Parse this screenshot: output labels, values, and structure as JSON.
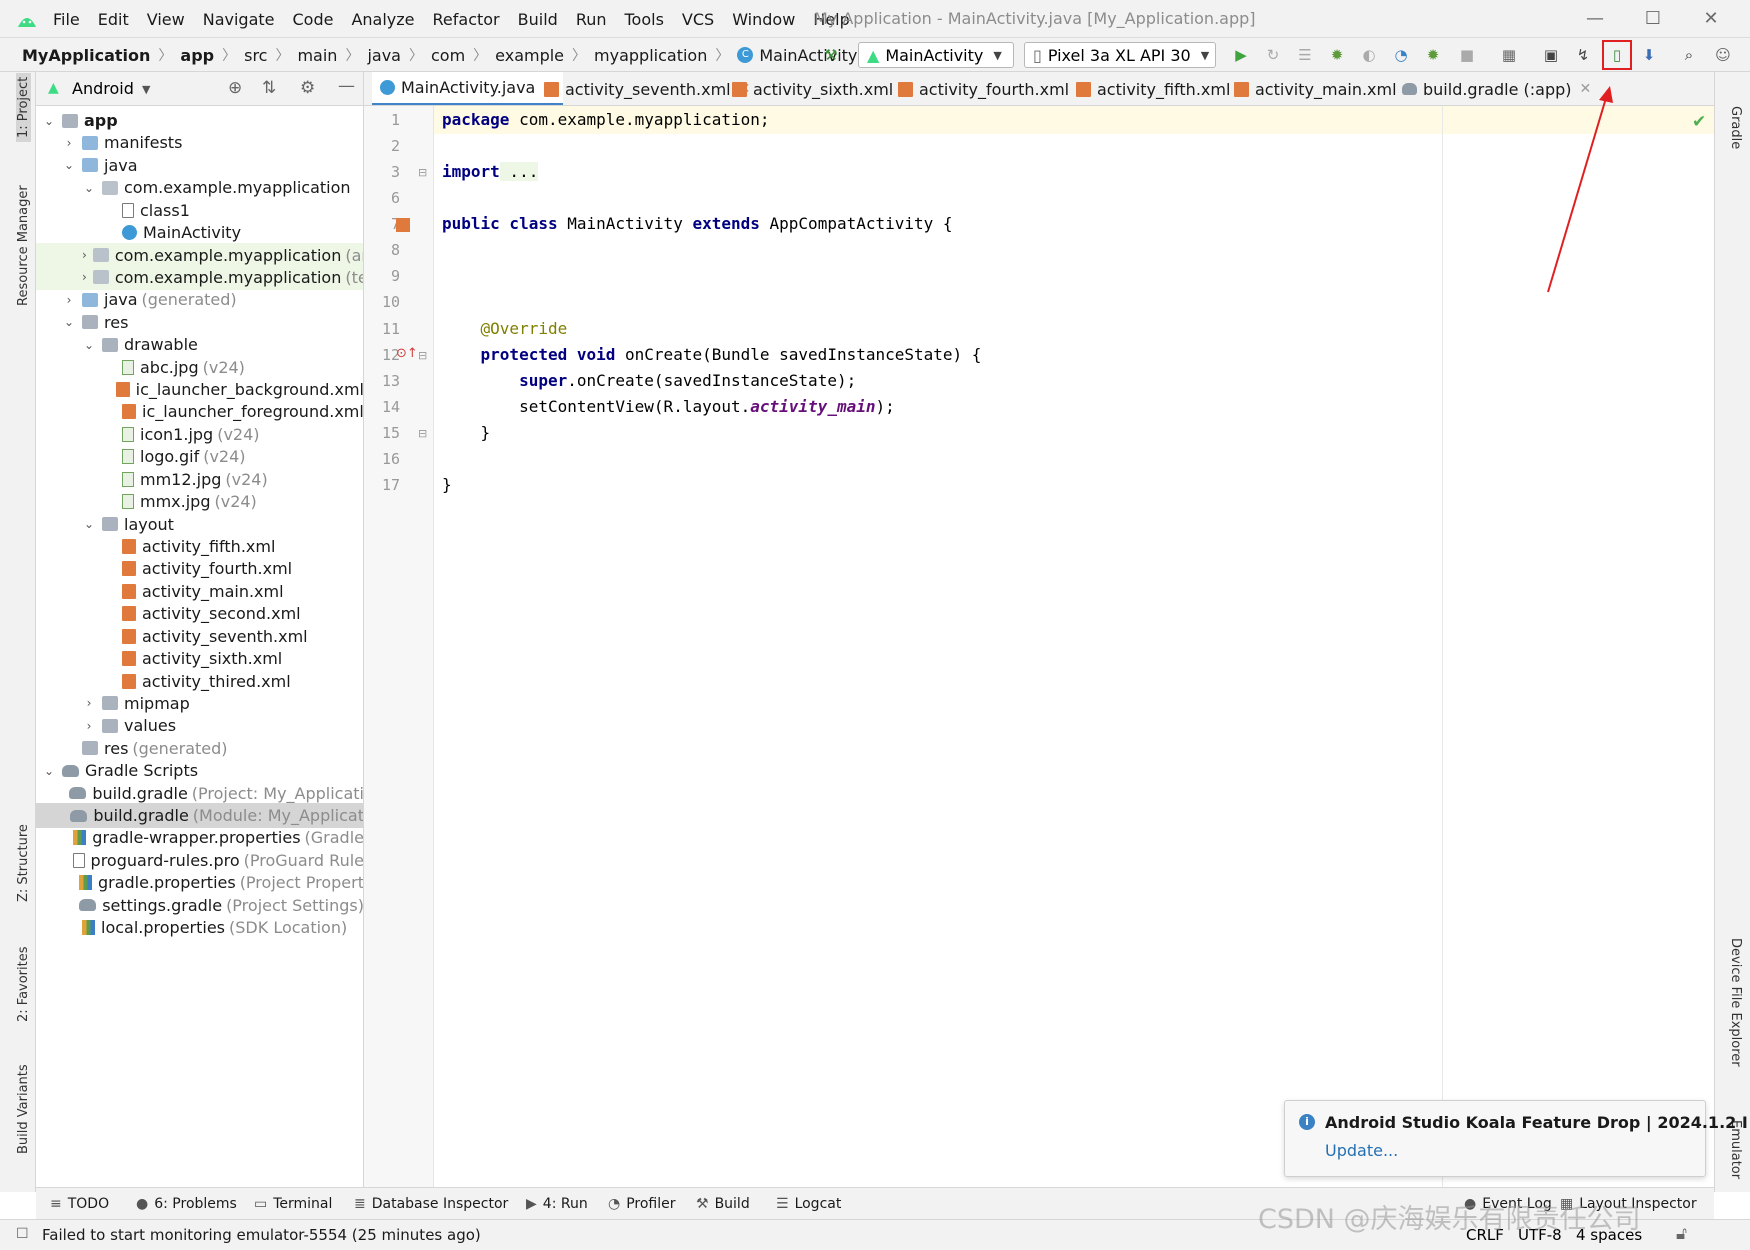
{
  "menu": [
    "File",
    "Edit",
    "View",
    "Navigate",
    "Code",
    "Analyze",
    "Refactor",
    "Build",
    "Run",
    "Tools",
    "VCS",
    "Window",
    "Help"
  ],
  "window_title": "My Application - MainActivity.java [My_Application.app]",
  "breadcrumbs": [
    "MyApplication",
    "app",
    "src",
    "main",
    "java",
    "com",
    "example",
    "myapplication",
    "MainActivity"
  ],
  "run_config": "MainActivity",
  "device": "Pixel 3a XL API 30",
  "project_view": "Android",
  "tree": [
    {
      "label": "app",
      "indent": 0,
      "tw": "v",
      "icon": "gfolder",
      "bold": true
    },
    {
      "label": "manifests",
      "indent": 1,
      "tw": ">",
      "icon": "folder"
    },
    {
      "label": "java",
      "indent": 1,
      "tw": "v",
      "icon": "folder"
    },
    {
      "label": "com.example.myapplication",
      "indent": 2,
      "tw": "v",
      "icon": "pkg"
    },
    {
      "label": "class1",
      "indent": 3,
      "tw": "",
      "icon": "file"
    },
    {
      "label": "MainActivity",
      "indent": 3,
      "tw": "",
      "icon": "cls"
    },
    {
      "label": "com.example.myapplication",
      "sub": "(ar",
      "indent": 2,
      "tw": ">",
      "icon": "pkg",
      "hl": true
    },
    {
      "label": "com.example.myapplication",
      "sub": "(te",
      "indent": 2,
      "tw": ">",
      "icon": "pkg",
      "hl": true
    },
    {
      "label": "java",
      "sub": "(generated)",
      "indent": 1,
      "tw": ">",
      "icon": "folder"
    },
    {
      "label": "res",
      "indent": 1,
      "tw": "v",
      "icon": "gfolder"
    },
    {
      "label": "drawable",
      "indent": 2,
      "tw": "v",
      "icon": "gfolder"
    },
    {
      "label": "abc.jpg",
      "sub": "(v24)",
      "indent": 3,
      "tw": "",
      "icon": "img"
    },
    {
      "label": "ic_launcher_background.xml",
      "indent": 3,
      "tw": "",
      "icon": "xml"
    },
    {
      "label": "ic_launcher_foreground.xml",
      "indent": 3,
      "tw": "",
      "icon": "xml"
    },
    {
      "label": "icon1.jpg",
      "sub": "(v24)",
      "indent": 3,
      "tw": "",
      "icon": "img"
    },
    {
      "label": "logo.gif",
      "sub": "(v24)",
      "indent": 3,
      "tw": "",
      "icon": "img"
    },
    {
      "label": "mm12.jpg",
      "sub": "(v24)",
      "indent": 3,
      "tw": "",
      "icon": "img"
    },
    {
      "label": "mmx.jpg",
      "sub": "(v24)",
      "indent": 3,
      "tw": "",
      "icon": "img"
    },
    {
      "label": "layout",
      "indent": 2,
      "tw": "v",
      "icon": "gfolder"
    },
    {
      "label": "activity_fifth.xml",
      "indent": 3,
      "tw": "",
      "icon": "xml"
    },
    {
      "label": "activity_fourth.xml",
      "indent": 3,
      "tw": "",
      "icon": "xml"
    },
    {
      "label": "activity_main.xml",
      "indent": 3,
      "tw": "",
      "icon": "xml"
    },
    {
      "label": "activity_second.xml",
      "indent": 3,
      "tw": "",
      "icon": "xml"
    },
    {
      "label": "activity_seventh.xml",
      "indent": 3,
      "tw": "",
      "icon": "xml"
    },
    {
      "label": "activity_sixth.xml",
      "indent": 3,
      "tw": "",
      "icon": "xml"
    },
    {
      "label": "activity_thired.xml",
      "indent": 3,
      "tw": "",
      "icon": "xml"
    },
    {
      "label": "mipmap",
      "indent": 2,
      "tw": ">",
      "icon": "gfolder"
    },
    {
      "label": "values",
      "indent": 2,
      "tw": ">",
      "icon": "gfolder"
    },
    {
      "label": "res",
      "sub": "(generated)",
      "indent": 1,
      "tw": "",
      "icon": "gfolder"
    },
    {
      "label": "Gradle Scripts",
      "indent": 0,
      "tw": "v",
      "icon": "gradle"
    },
    {
      "label": "build.gradle",
      "sub": "(Project: My_Applicati",
      "indent": 1,
      "tw": "",
      "icon": "gradle"
    },
    {
      "label": "build.gradle",
      "sub": "(Module: My_Applicat",
      "indent": 1,
      "tw": "",
      "icon": "gradle",
      "sel": true
    },
    {
      "label": "gradle-wrapper.properties",
      "sub": "(Gradle",
      "indent": 1,
      "tw": "",
      "icon": "prop"
    },
    {
      "label": "proguard-rules.pro",
      "sub": "(ProGuard Rule",
      "indent": 1,
      "tw": "",
      "icon": "file"
    },
    {
      "label": "gradle.properties",
      "sub": "(Project Propert",
      "indent": 1,
      "tw": "",
      "icon": "prop"
    },
    {
      "label": "settings.gradle",
      "sub": "(Project Settings)",
      "indent": 1,
      "tw": "",
      "icon": "gradle"
    },
    {
      "label": "local.properties",
      "sub": "(SDK Location)",
      "indent": 1,
      "tw": "",
      "icon": "prop"
    }
  ],
  "tabs": [
    {
      "label": "MainActivity.java",
      "icon": "cls",
      "active": true
    },
    {
      "label": "activity_seventh.xml",
      "icon": "xml"
    },
    {
      "label": "activity_sixth.xml",
      "icon": "xml"
    },
    {
      "label": "activity_fourth.xml",
      "icon": "xml"
    },
    {
      "label": "activity_fifth.xml",
      "icon": "xml"
    },
    {
      "label": "activity_main.xml",
      "icon": "xml"
    },
    {
      "label": "build.gradle (:app)",
      "icon": "gr"
    }
  ],
  "line_numbers": [
    "1",
    "2",
    "3",
    "6",
    "7",
    "8",
    "9",
    "10",
    "11",
    "12",
    "13",
    "14",
    "15",
    "16",
    "17"
  ],
  "code": {
    "l1_kw": "package",
    "l1_rest": " com.example.myapplication;",
    "l3_kw": "import",
    "l3_rest": " ...",
    "l7_kw1": "public class",
    "l7_mid": " MainActivity ",
    "l7_kw2": "extends",
    "l7_rest": " AppCompatActivity {",
    "l11": "    @Override",
    "l12_ind": "    ",
    "l12_kw": "protected void",
    "l12_rest": " onCreate(Bundle savedInstanceState) {",
    "l13_ind": "        ",
    "l13_kw": "super",
    "l13_rest": ".onCreate(savedInstanceState);",
    "l14_a": "        setContentView(R.layout.",
    "l14_it": "activity_main",
    "l14_b": ");",
    "l15": "    }",
    "l17": "}"
  },
  "left_stripe": [
    "1: Project",
    "Resource Manager",
    "Z: Structure",
    "2: Favorites",
    "Build Variants"
  ],
  "right_stripe": [
    "Gradle",
    "Device File Explorer",
    "Emulator"
  ],
  "bottom_tabs": [
    {
      "label": "TODO",
      "icon": "≡"
    },
    {
      "label": "6: Problems",
      "icon": "●"
    },
    {
      "label": "Terminal",
      "icon": "▭"
    },
    {
      "label": "Database Inspector",
      "icon": "≣"
    },
    {
      "label": "4: Run",
      "icon": "▶"
    },
    {
      "label": "Profiler",
      "icon": "◔"
    },
    {
      "label": "Build",
      "icon": "⚒"
    },
    {
      "label": "Logcat",
      "icon": "☰"
    },
    {
      "label": "Event Log",
      "icon": "●"
    },
    {
      "label": "Layout Inspector",
      "icon": "▦"
    }
  ],
  "status_message": "Failed to start monitoring emulator-5554 (25 minutes ago)",
  "status_right": [
    "CRLF",
    "UTF-8",
    "4 spaces"
  ],
  "notification": {
    "title": "Android Studio Koala Feature Drop | 2024.1.2 I",
    "link": "Update..."
  },
  "watermark": "CSDN @庆海娱乐有限责任公司",
  "colors": {
    "accent": "#4083c9",
    "highlight_box": "#e02020",
    "arrow": "#e02020"
  }
}
